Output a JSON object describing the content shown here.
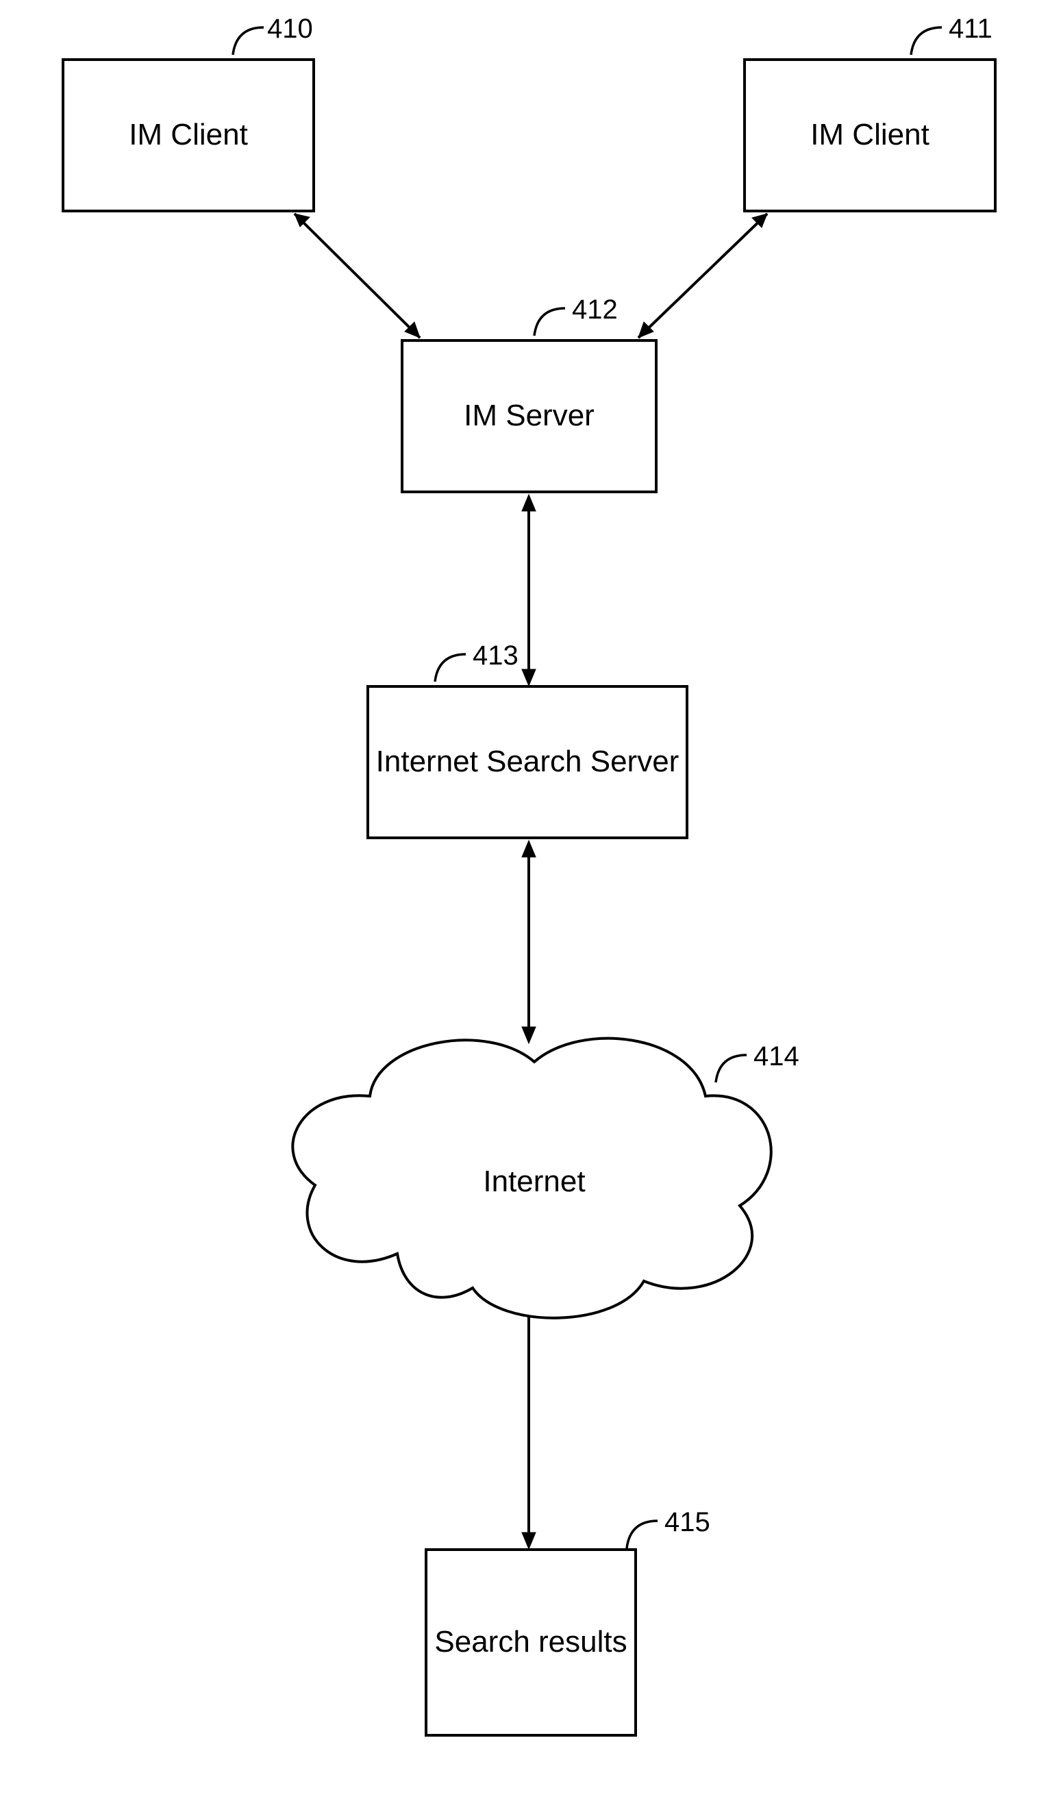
{
  "nodes": {
    "im_client_left": {
      "ref": "410",
      "label": "IM Client"
    },
    "im_client_right": {
      "ref": "411",
      "label": "IM Client"
    },
    "im_server": {
      "ref": "412",
      "label": "IM Server"
    },
    "search_server": {
      "ref": "413",
      "label": "Internet Search Server"
    },
    "internet": {
      "ref": "414",
      "label": "Internet"
    },
    "search_results": {
      "ref": "415",
      "label": "Search results"
    }
  },
  "edges": [
    {
      "from": "im_client_left",
      "to": "im_server",
      "bidirectional": true
    },
    {
      "from": "im_client_right",
      "to": "im_server",
      "bidirectional": true
    },
    {
      "from": "im_server",
      "to": "search_server",
      "bidirectional": true
    },
    {
      "from": "search_server",
      "to": "internet",
      "bidirectional": true
    },
    {
      "from": "internet",
      "to": "search_results",
      "bidirectional": false,
      "direction": "down"
    }
  ]
}
